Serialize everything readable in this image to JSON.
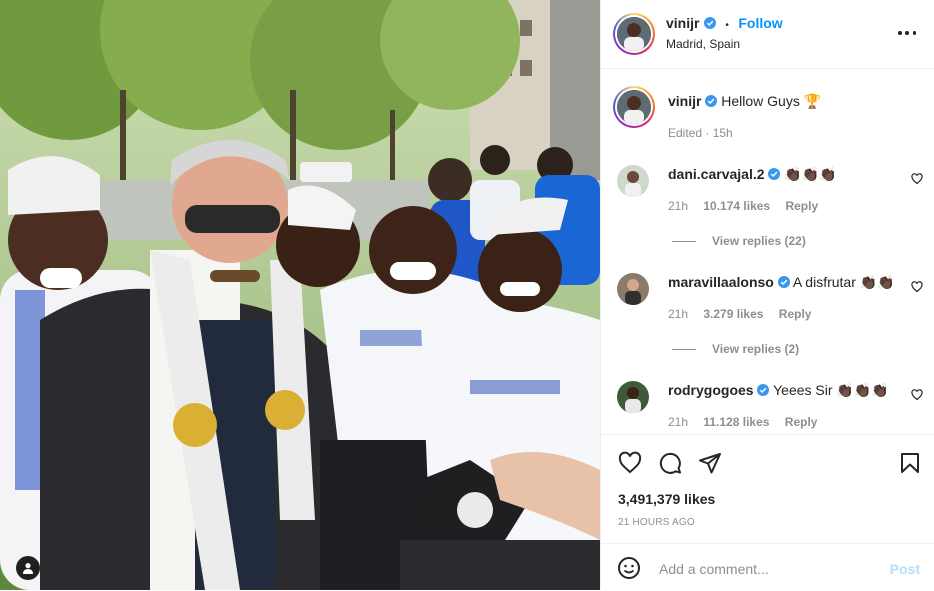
{
  "post": {
    "username": "vinijr",
    "follow_label": "Follow",
    "separator": "•",
    "location": "Madrid, Spain"
  },
  "caption": {
    "username": "vinijr",
    "text": "Hellow Guys 🏆",
    "edited": "Edited · 15h"
  },
  "comments": [
    {
      "username": "dani.carvajal.2",
      "text": "👏🏿👏🏿👏🏿",
      "age": "21h",
      "likes": "10.174 likes",
      "reply": "Reply",
      "view_replies": "View replies (22)"
    },
    {
      "username": "maravillaalonso",
      "text": "A disfrutar 👏🏿👏🏿",
      "age": "21h",
      "likes": "3.279 likes",
      "reply": "Reply",
      "view_replies": "View replies (2)"
    },
    {
      "username": "rodrygogoes",
      "text": "Yeees Sir 👏🏿👏🏿👏🏿",
      "age": "21h",
      "likes": "11.128 likes",
      "reply": "Reply"
    }
  ],
  "likes_count": "3,491,379 likes",
  "post_time": "21 HOURS AGO",
  "add_comment": {
    "placeholder": "Add a comment...",
    "post_label": "Post"
  },
  "colors": {
    "link": "#0095f6",
    "muted": "#8e8e8e",
    "text": "#262626",
    "post_disabled": "#b2dffc"
  },
  "icons": [
    "verified-icon",
    "more-icon",
    "heart-icon",
    "comment-icon",
    "share-icon",
    "bookmark-icon",
    "emoji-icon",
    "tagged-user-icon"
  ]
}
